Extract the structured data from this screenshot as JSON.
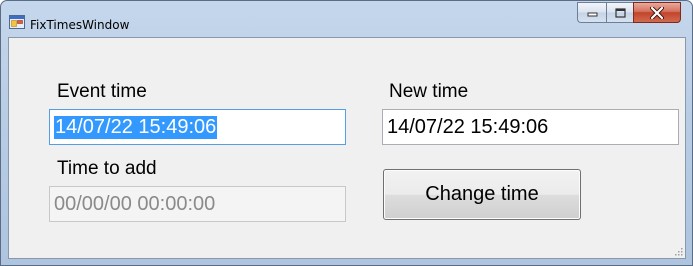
{
  "window": {
    "title": "FixTimesWindow",
    "icons": {
      "app": "windows-form-icon",
      "minimize": "minimize-icon",
      "maximize": "maximize-icon",
      "close": "close-icon"
    }
  },
  "form": {
    "event_time": {
      "label": "Event time",
      "value": "14/07/22 15:49:06"
    },
    "new_time": {
      "label": "New time",
      "value": "14/07/22 15:49:06"
    },
    "time_to_add": {
      "label": "Time to add",
      "value": "00/00/00 00:00:00"
    },
    "change_button": {
      "label": "Change time"
    }
  },
  "colors": {
    "selection": "#3399ff",
    "close_button": "#c2432b",
    "client_bg": "#f0f0f0"
  }
}
